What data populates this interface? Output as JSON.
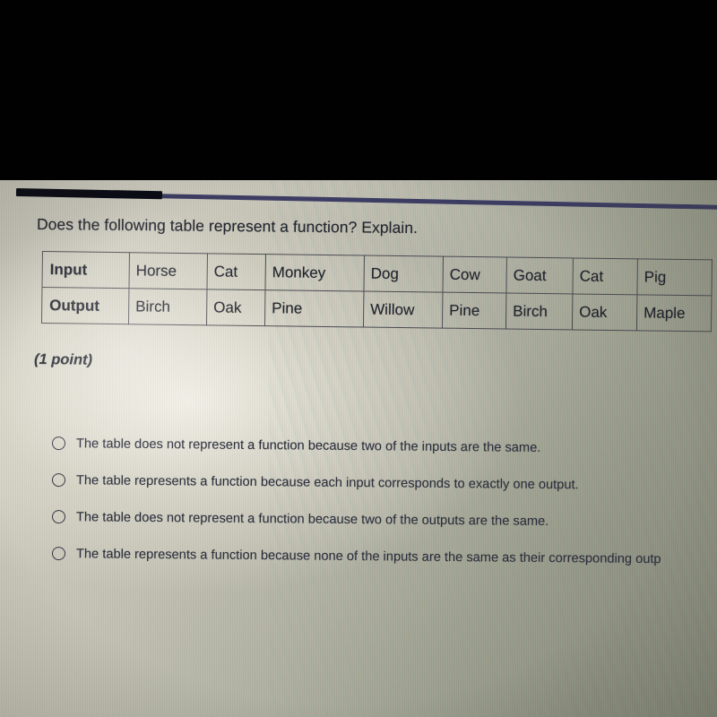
{
  "screen": {
    "progress_bar": {
      "name": "quiz-progress-bar",
      "fill_color": "#090a14",
      "track_color": "#3d3d63",
      "fill_percent": 21
    },
    "question": {
      "prompt": "Does the following table represent a function? Explain.",
      "points_label": "(1 point)"
    },
    "table": {
      "rows": [
        {
          "header": "Input",
          "cells": [
            "Horse",
            "Cat",
            "Monkey",
            "Dog",
            "Cow",
            "Goat",
            "Cat",
            "Pig"
          ]
        },
        {
          "header": "Output",
          "cells": [
            "Birch",
            "Oak",
            "Pine",
            "Willow",
            "Pine",
            "Birch",
            "Oak",
            "Maple"
          ]
        }
      ]
    },
    "options": [
      {
        "label": "The table does not represent a function because two of the inputs are the same.",
        "selected": false
      },
      {
        "label": "The table represents a function because each input corresponds to exactly one output.",
        "selected": false
      },
      {
        "label": "The table does not represent a function because two of the outputs are the same.",
        "selected": false
      },
      {
        "label": "The table represents a function because none of the inputs are the same as their corresponding outp",
        "selected": false
      }
    ]
  },
  "colors": {
    "letterbox": "#010101",
    "text": "#23252f",
    "table_border": "#4a4b52",
    "progress_accent": "#3d3d63"
  }
}
